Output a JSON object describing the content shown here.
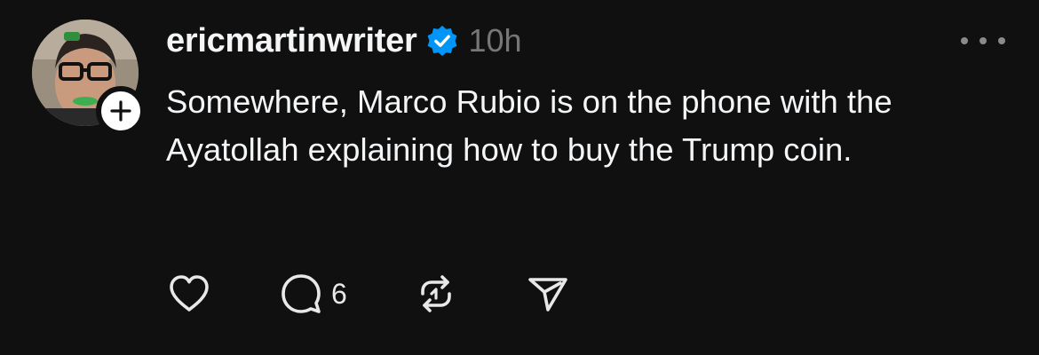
{
  "post": {
    "username": "ericmartinwriter",
    "verified": true,
    "timestamp": "10h",
    "text": "Somewhere, Marco Rubio is on the phone with the Ayatollah explaining how to buy the Trump coin.",
    "actions": {
      "reply_count": "6"
    }
  },
  "icons": {
    "avatar": "avatar",
    "follow": "plus-icon",
    "verified": "verified-badge-icon",
    "more": "more-options-icon",
    "like": "heart-icon",
    "reply": "comment-icon",
    "repost": "repost-icon",
    "share": "send-icon"
  },
  "colors": {
    "background": "#101010",
    "text": "#f3f5f7",
    "muted": "#777777",
    "verified": "#0095f6"
  }
}
